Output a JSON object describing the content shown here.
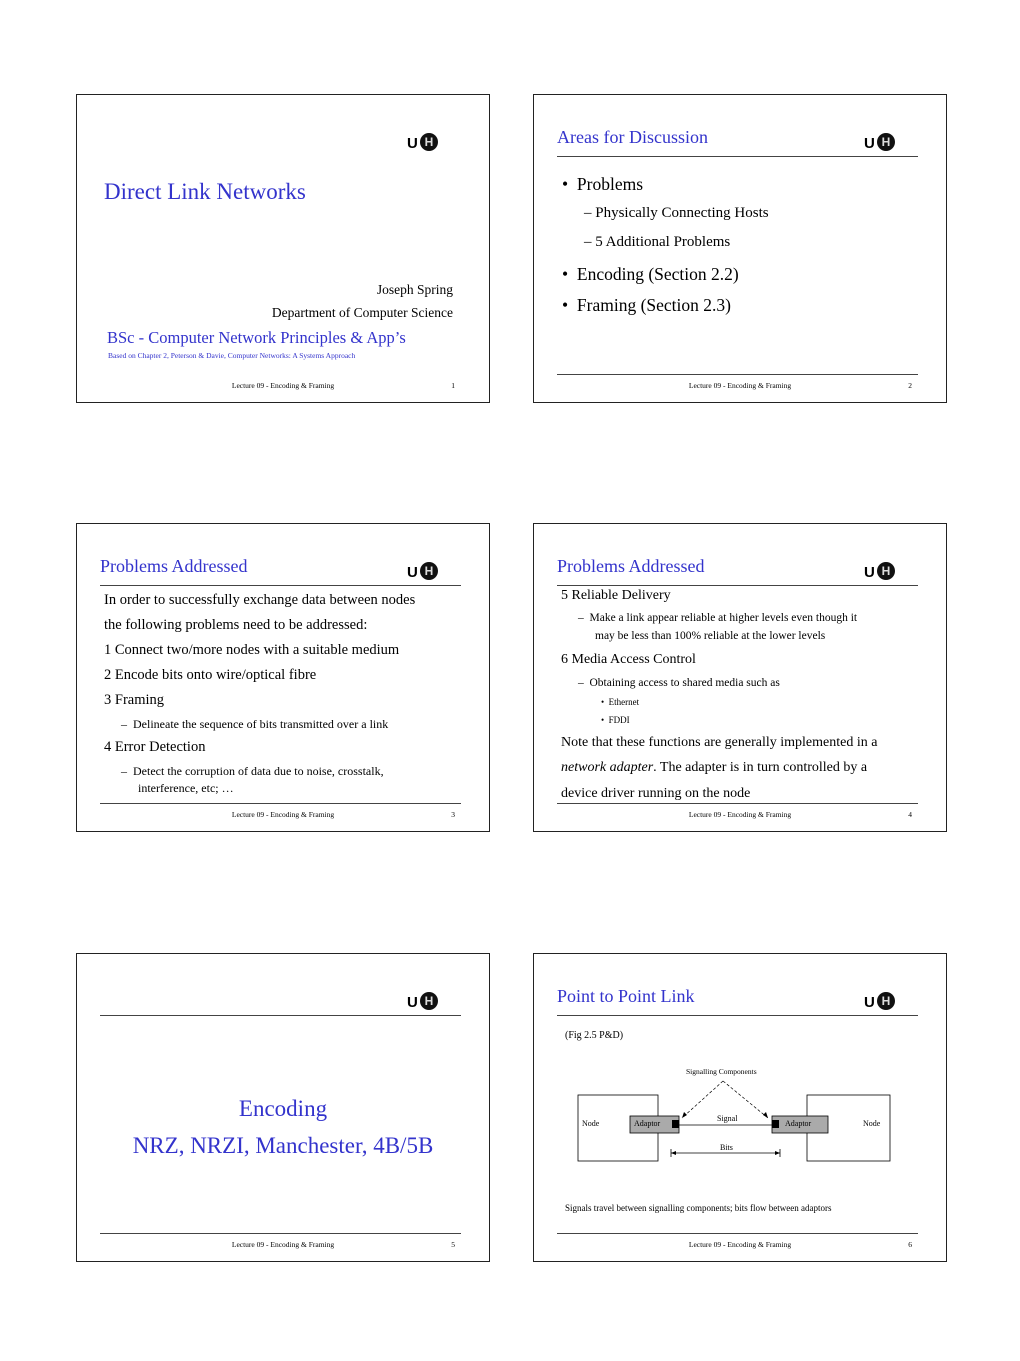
{
  "footer_text": "Lecture  09 - Encoding & Framing",
  "colors": {
    "title": "#3333cc",
    "text": "#000000",
    "adaptor_fill": "#aaaaaa"
  },
  "logo": {
    "u": "U",
    "h": "H",
    "icon": "uh-logo-icon"
  },
  "slides": [
    {
      "number": "1",
      "title": "Direct Link Networks",
      "author": "Joseph Spring",
      "department": "Department of Computer Science",
      "course": "BSc - Computer Network Principles & App’s",
      "source": "Based on Chapter 2, Peterson & Davie, Computer Networks: A Systems Approach"
    },
    {
      "number": "2",
      "title": "Areas for Discussion",
      "bullets": [
        {
          "text": "Problems",
          "sub": [
            "Physically Connecting Hosts",
            "5 Additional Problems"
          ]
        },
        {
          "text": "Encoding (Section 2.2)"
        },
        {
          "text": "Framing (Section 2.3)"
        }
      ]
    },
    {
      "number": "3",
      "title": "Problems Addressed",
      "intro1": "In order to successfully exchange data between nodes",
      "intro2": "the following problems need to be addressed:",
      "items": [
        {
          "text": "1  Connect two/more nodes with a suitable medium"
        },
        {
          "text": "2  Encode bits onto wire/optical fibre"
        },
        {
          "text": "3  Framing",
          "sub": "Delineate the sequence of bits transmitted over a link"
        },
        {
          "text": "4  Error Detection",
          "sub": "Detect the corruption of data due to noise, crosstalk,",
          "sub2": "interference, etc; …"
        }
      ]
    },
    {
      "number": "4",
      "title": "Problems Addressed",
      "item5": "5  Reliable Delivery",
      "item5_sub1": "Make a link appear reliable at higher levels even though it",
      "item5_sub2": "may be less than 100% reliable at the lower levels",
      "item6": "6  Media Access Control",
      "item6_sub": "Obtaining access to shared media such as",
      "item6_subsub": [
        "Ethernet",
        "FDDI"
      ],
      "note1": "Note that these functions are generally implemented in a",
      "note2_italic": "network adapter",
      "note2_rest": ".   The adapter is in turn controlled by a",
      "note3": "device driver running on the node"
    },
    {
      "number": "5",
      "title1": "Encoding",
      "title2": "NRZ, NRZI, Manchester, 4B/5B"
    },
    {
      "number": "6",
      "title": "Point to Point Link",
      "fig_ref": "(Fig 2.5 P&D)",
      "diagram": {
        "signalling_label": "Signalling Components",
        "node_left": "Node",
        "node_right": "Node",
        "adaptor_left": "Adaptor",
        "adaptor_right": "Adaptor",
        "signal_label": "Signal",
        "bits_label": "Bits"
      },
      "caption": "Signals travel between signalling components; bits flow between adaptors"
    }
  ]
}
